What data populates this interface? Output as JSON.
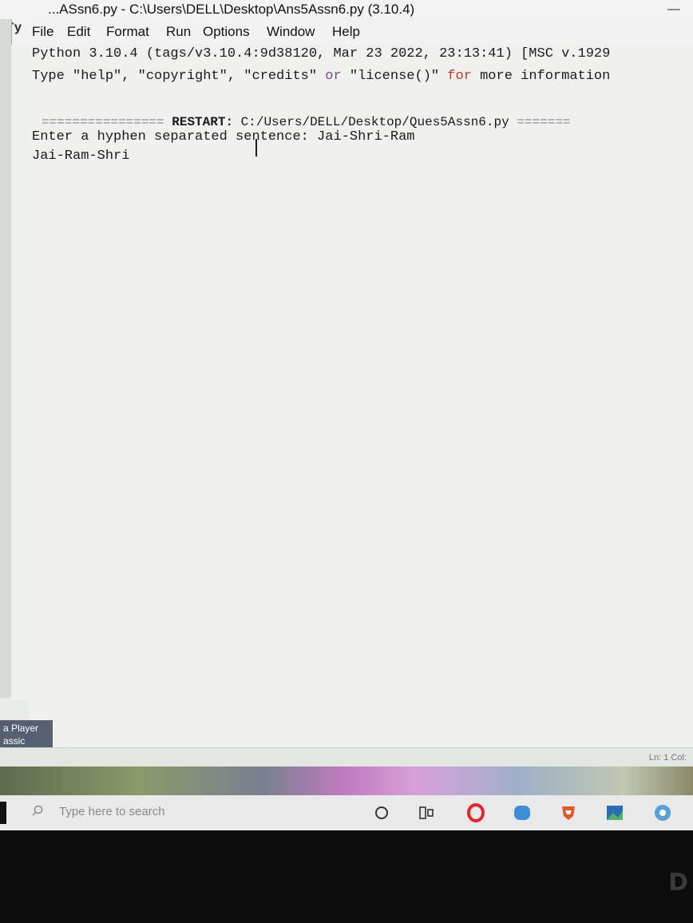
{
  "window": {
    "title": "...ASsn6.py - C:\\Users\\DELL\\Desktop\\Ans5Assn6.py (3.10.4)",
    "minimize_symbol": "—"
  },
  "menubar": {
    "app_icon_text": "Ty",
    "items": [
      "File",
      "Edit",
      "Format",
      "Run",
      "Options",
      "Window",
      "Help"
    ]
  },
  "shell": {
    "banner_line1": "Python 3.10.4 (tags/v3.10.4:9d38120, Mar 23 2022, 23:13:41) [MSC v.1929",
    "banner_line2_a": "Type \"help\", \"copyright\", \"credits\" ",
    "banner_line2_or": "or",
    "banner_line2_b": " \"license()\" ",
    "banner_line2_for": "for",
    "banner_line2_c": " more information",
    "restart_left": "================ ",
    "restart_label": "RESTART:",
    "restart_path": " C:/Users/DELL/Desktop/Ques5Assn6.py ",
    "restart_right": "=======",
    "prompt_text": "Enter a hyphen separated sentence: Jai-Shri-Ram",
    "output_text": "Jai-Ram-Shri"
  },
  "statusbar": {
    "position": "Ln: 1  Col:"
  },
  "desktop": {
    "shortcut_label_line1": "a Player",
    "shortcut_label_line2": "assic"
  },
  "taskbar": {
    "search_placeholder": "Type here to search",
    "icons": [
      "cortana-icon",
      "task-view-icon",
      "opera-icon",
      "messaging-icon",
      "brave-icon",
      "photos-icon",
      "chrome-icon"
    ]
  },
  "bezel": {
    "brand_text": "D"
  }
}
